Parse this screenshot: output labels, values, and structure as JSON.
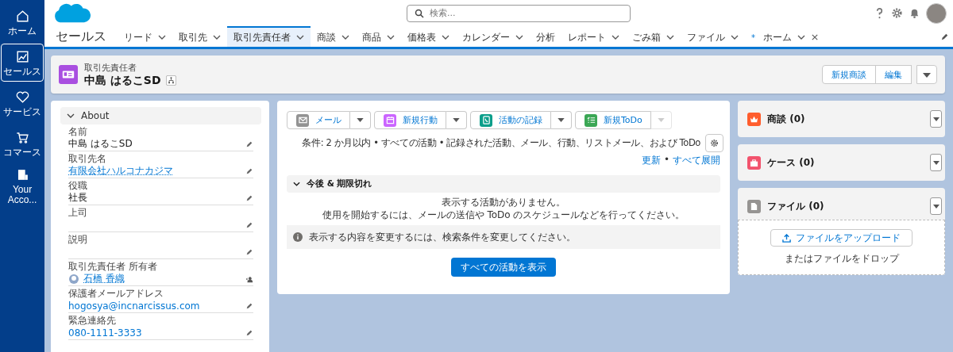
{
  "nav": [
    {
      "label": "ホーム",
      "kind": "home",
      "selected": false
    },
    {
      "label": "セールス",
      "kind": "chart",
      "selected": true
    },
    {
      "label": "サービス",
      "kind": "heart",
      "selected": false
    },
    {
      "label": "コマース",
      "kind": "cart",
      "selected": false
    },
    {
      "label": "Your Acco...",
      "kind": "building",
      "selected": false
    }
  ],
  "search": {
    "placeholder": "検索..."
  },
  "app_name": "セールス",
  "tabs": [
    {
      "label": "リード",
      "menu": true,
      "selected": false
    },
    {
      "label": "取引先",
      "menu": true,
      "selected": false
    },
    {
      "label": "取引先責任者",
      "menu": true,
      "selected": true
    },
    {
      "label": "商談",
      "menu": true,
      "selected": false
    },
    {
      "label": "商品",
      "menu": true,
      "selected": false
    },
    {
      "label": "価格表",
      "menu": true,
      "selected": false
    },
    {
      "label": "カレンダー",
      "menu": true,
      "selected": false
    },
    {
      "label": "分析",
      "menu": false,
      "selected": false
    },
    {
      "label": "レポート",
      "menu": true,
      "selected": false
    },
    {
      "label": "ごみ箱",
      "menu": true,
      "selected": false
    },
    {
      "label": "ファイル",
      "menu": true,
      "selected": false
    },
    {
      "label": "ホーム",
      "prefix": "*",
      "menu": true,
      "closable": true,
      "selected": false
    }
  ],
  "record": {
    "type": "取引先責任者",
    "name": "中島 はるこSD",
    "actions": [
      "新規商談",
      "編集"
    ]
  },
  "about": {
    "title": "About",
    "fields": [
      {
        "label": "名前",
        "value": "中島 はるこSD",
        "kind": "text"
      },
      {
        "label": "取引先名",
        "value": "有限会社ハルコナカジマ",
        "kind": "link"
      },
      {
        "label": "役職",
        "value": "社長",
        "kind": "text"
      },
      {
        "label": "上司",
        "kind": "text"
      },
      {
        "label": "説明",
        "kind": "text"
      },
      {
        "label": "取引先責任者 所有者",
        "value": "石橋 香織",
        "kind": "owner"
      },
      {
        "label": "保護者メールアドレス",
        "value": "hogosya@incnarcissus.com",
        "kind": "plainlink"
      },
      {
        "label": "緊急連絡先",
        "value": "080-1111-3333",
        "kind": "plainlink"
      }
    ]
  },
  "activity": {
    "buttons": [
      {
        "label": "メール",
        "color": "#939393",
        "kind": "mail",
        "menu_disabled": false
      },
      {
        "label": "新規行動",
        "color": "#cb65ff",
        "kind": "calendar",
        "menu_disabled": false
      },
      {
        "label": "活動の記録",
        "color": "#0b9e8a",
        "kind": "phone",
        "menu_disabled": false
      },
      {
        "label": "新規ToDo",
        "color": "#3ba755",
        "kind": "list",
        "menu_disabled": true
      }
    ],
    "filter": "条件: 2 か月以内 • すべての活動 • 記録された活動、メール、行動、リストメール、および ToDo",
    "links": [
      "更新",
      "すべて展開"
    ],
    "link_separator": "•",
    "section": "今後 & 期限切れ",
    "empty": [
      "表示する活動がありません。",
      "使用を開始するには、メールの送信や ToDo のスケジュールなどを行ってください。"
    ],
    "info": "表示する内容を変更するには、検索条件を変更してください。",
    "show_all": "すべての活動を表示"
  },
  "related": [
    {
      "title": "商談 (0)",
      "color": "#ff5d2d",
      "kind": "crown"
    },
    {
      "title": "ケース (0)",
      "color": "#f2536d",
      "kind": "case"
    },
    {
      "title": "ファイル (0)",
      "color": "#969492",
      "kind": "file",
      "upload": "ファイルをアップロード",
      "drop": "またはファイルをドロップ"
    }
  ]
}
